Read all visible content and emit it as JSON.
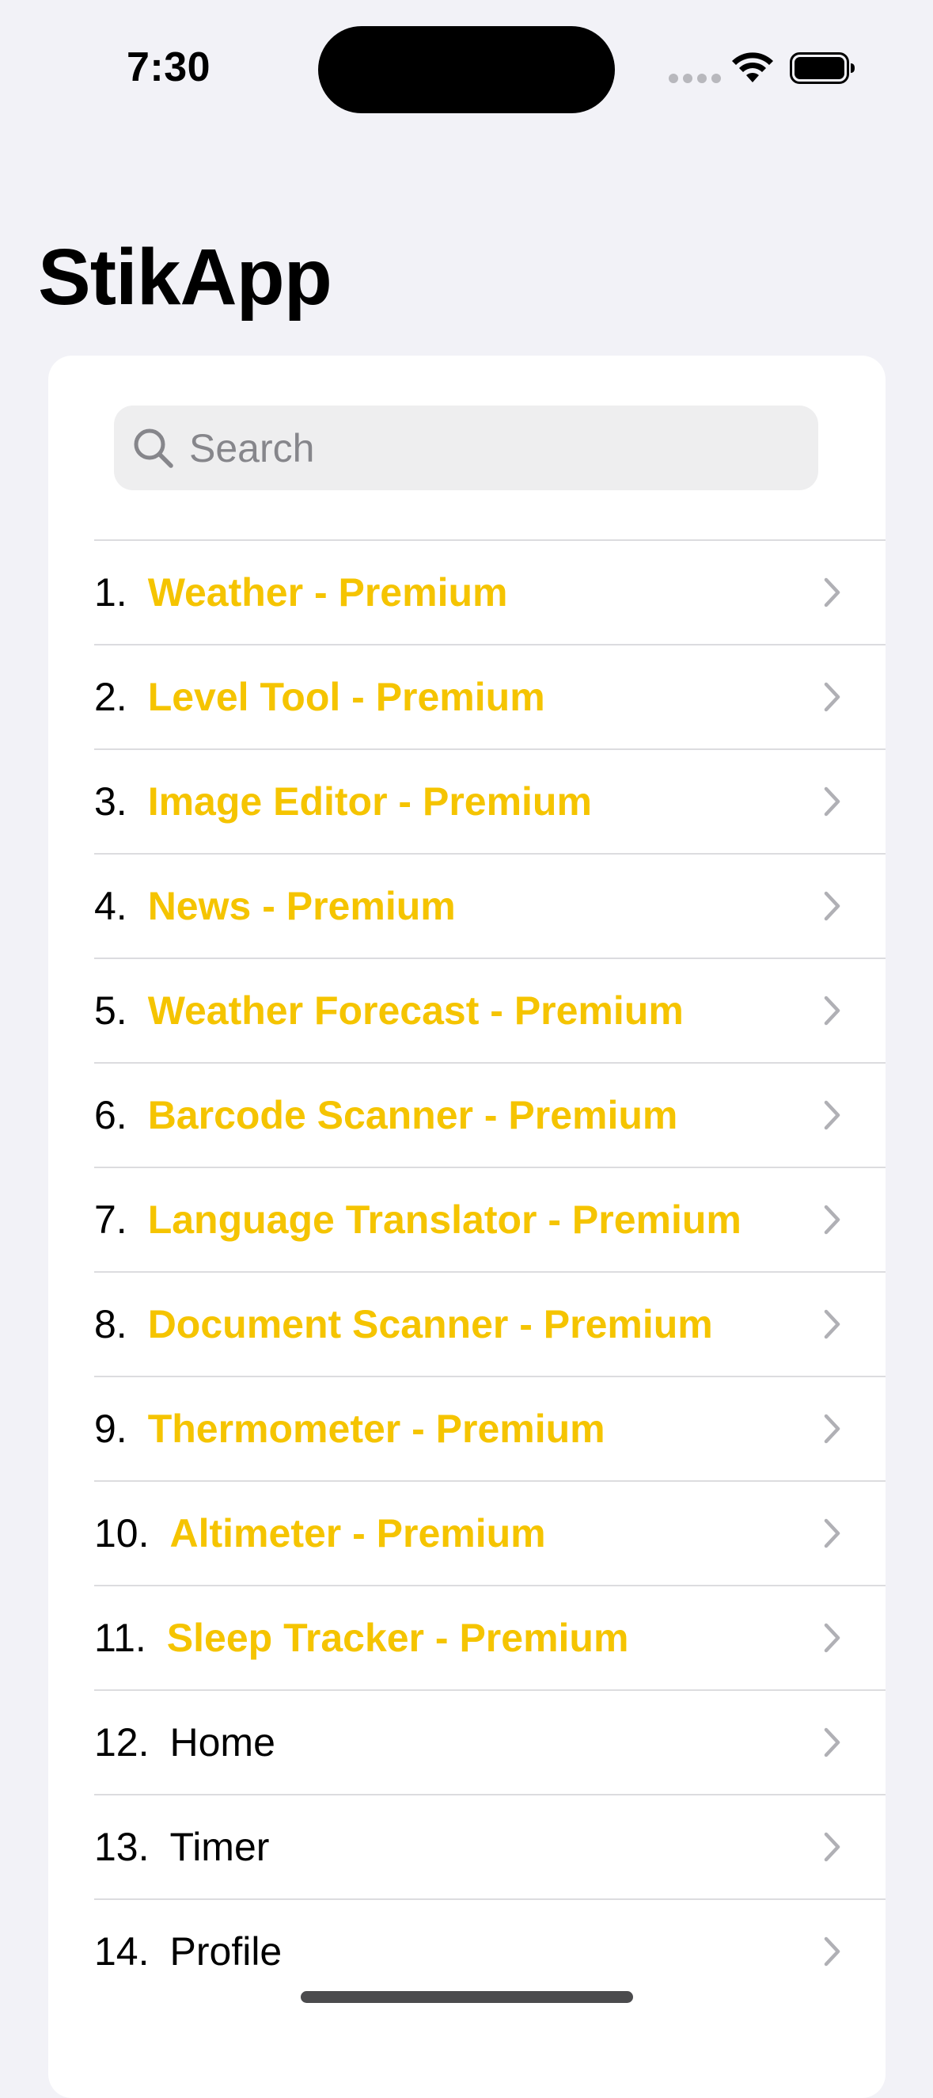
{
  "status_bar": {
    "time": "7:30"
  },
  "app": {
    "title": "StikApp"
  },
  "search": {
    "placeholder": "Search",
    "value": ""
  },
  "colors": {
    "premium_accent": "#F5C400",
    "background": "#F2F2F7",
    "card": "#FFFFFF"
  },
  "items": [
    {
      "number": "1.",
      "label": "Weather - Premium",
      "premium": true
    },
    {
      "number": "2.",
      "label": "Level Tool - Premium",
      "premium": true
    },
    {
      "number": "3.",
      "label": "Image Editor - Premium",
      "premium": true
    },
    {
      "number": "4.",
      "label": "News - Premium",
      "premium": true
    },
    {
      "number": "5.",
      "label": "Weather Forecast - Premium",
      "premium": true
    },
    {
      "number": "6.",
      "label": "Barcode Scanner - Premium",
      "premium": true
    },
    {
      "number": "7.",
      "label": "Language Translator - Premium",
      "premium": true
    },
    {
      "number": "8.",
      "label": "Document Scanner - Premium",
      "premium": true
    },
    {
      "number": "9.",
      "label": "Thermometer - Premium",
      "premium": true
    },
    {
      "number": "10.",
      "label": "Altimeter - Premium",
      "premium": true
    },
    {
      "number": "11.",
      "label": "Sleep Tracker - Premium",
      "premium": true
    },
    {
      "number": "12.",
      "label": "Home",
      "premium": false
    },
    {
      "number": "13.",
      "label": "Timer",
      "premium": false
    },
    {
      "number": "14.",
      "label": "Profile",
      "premium": false
    }
  ],
  "icons": {
    "search": "magnifying-glass",
    "row_accessory": "chevron-right"
  }
}
